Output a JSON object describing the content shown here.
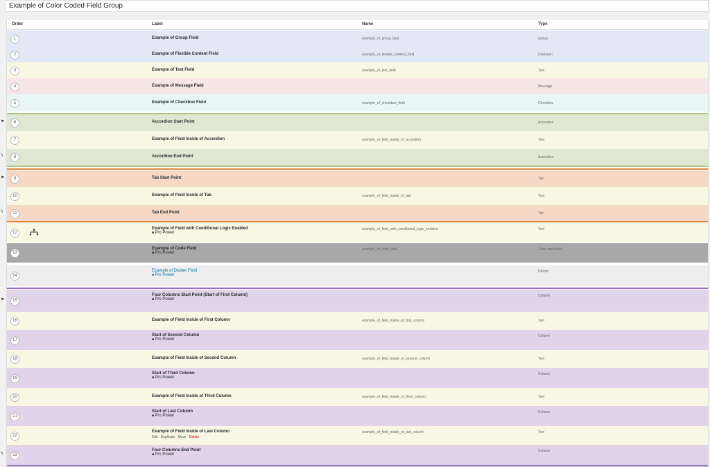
{
  "page_title": "Example of Color Coded Field Group",
  "columns": {
    "order": "Order",
    "label": "Label",
    "name": "Name",
    "type": "Type"
  },
  "pro_power": "Pro Power",
  "actions": {
    "edit": "Edit",
    "duplicate": "Duplicate",
    "move": "Move",
    "delete": "Delete"
  },
  "rows": [
    {
      "order": "1",
      "label": "Example of Group Field",
      "name": "example_of_group_field",
      "type": "Group",
      "bg": "#e2e8f6"
    },
    {
      "order": "2",
      "label": "Example of Flexible Content Field",
      "name": "example_of_flexible_content_field",
      "type": "Unknown",
      "bg": "#e2e8f6"
    },
    {
      "order": "3",
      "label": "Example of Text Field",
      "name": "example_of_text_field",
      "type": "Text",
      "bg": "#f7f7e3"
    },
    {
      "order": "4",
      "label": "Example of Message Field",
      "name": "",
      "type": "Message",
      "bg": "#f7e6e8"
    },
    {
      "order": "5",
      "label": "Example of Checkbox Field",
      "name": "example_of_checkbox_field",
      "type": "Checkbox",
      "bg": "#e9f6f6"
    },
    {
      "order": "6",
      "label": "Accordion Start Point",
      "name": "",
      "type": "Accordion",
      "bg": "#dee8d3"
    },
    {
      "order": "7",
      "label": "Example of Field Inside of Accordion",
      "name": "example_of_field_inside_of_accordion",
      "type": "Text",
      "bg": "#f7f7e3"
    },
    {
      "order": "8",
      "label": "Accordion End Point",
      "name": "",
      "type": "Accordion",
      "bg": "#dee8d3"
    },
    {
      "order": "9",
      "label": "Tab Start Point",
      "name": "",
      "type": "Tab",
      "bg": "#f6d8c4"
    },
    {
      "order": "10",
      "label": "Example of Field Inside of Tab",
      "name": "example_of_field_inside_of_tab",
      "type": "Text",
      "bg": "#f7f7e3"
    },
    {
      "order": "11",
      "label": "Tab End Point",
      "name": "",
      "type": "Tab",
      "bg": "#f6d8c4"
    },
    {
      "order": "12",
      "label": "Example of Field with Conditional Logic Enabled",
      "name": "example_of_field_with_conditional_logic_enabled",
      "type": "Text",
      "bg": "#f7f7e3"
    },
    {
      "order": "13",
      "label": "Example of Code Field",
      "name": "example_of_code_field",
      "type": "Code area field",
      "bg": "#a8a8a8"
    },
    {
      "order": "14",
      "label": "Example of Divider Field",
      "name": "",
      "type": "Divider",
      "bg": "#eeeeee"
    },
    {
      "order": "15",
      "label": "Four Columns Start Point (Start of First Column)",
      "name": "",
      "type": "Column",
      "bg": "#e0d3ea"
    },
    {
      "order": "16",
      "label": "Example of Field Inside of First Column",
      "name": "example_of_field_inside_of_first_column",
      "type": "Text",
      "bg": "#f7f7e3"
    },
    {
      "order": "17",
      "label": "Start of Second Column",
      "name": "",
      "type": "Column",
      "bg": "#e0d3ea"
    },
    {
      "order": "18",
      "label": "Example of Field Inside of Second Column",
      "name": "example_of_field_inside_of_second_column",
      "type": "Text",
      "bg": "#f7f7e3"
    },
    {
      "order": "19",
      "label": "Start of Third Column",
      "name": "",
      "type": "Column",
      "bg": "#e0d3ea"
    },
    {
      "order": "20",
      "label": "Example of Field Inside of Third Column",
      "name": "example_of_field_inside_of_third_column",
      "type": "Text",
      "bg": "#f7f7e3"
    },
    {
      "order": "21",
      "label": "Start of Last Column",
      "name": "",
      "type": "Column",
      "bg": "#e0d3ea"
    },
    {
      "order": "22",
      "label": "Example of Field Inside of Last Column",
      "name": "example_of_field_inside_of_last_column",
      "type": "Text",
      "bg": "#f7f7e3"
    },
    {
      "order": "23",
      "label": "Four Columns End Point",
      "name": "",
      "type": "Column",
      "bg": "#e0d3ea"
    }
  ],
  "separator_colors": {
    "green": "#a9c77e",
    "orange": "#e08a3c",
    "purple": "#9b6bc9"
  },
  "icons": {
    "flag": "flag-icon",
    "bolt": "bolt-icon",
    "conditional": "conditional-logic-icon",
    "lock": "lock-icon"
  }
}
